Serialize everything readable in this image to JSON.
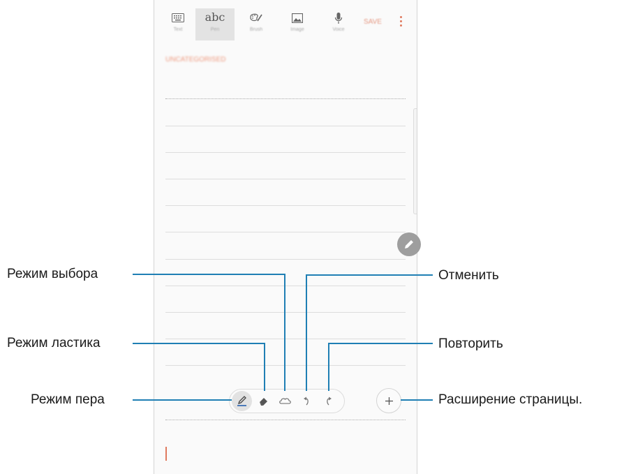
{
  "toolbar": {
    "items": [
      {
        "label": "Text",
        "icon": "keyboard-icon"
      },
      {
        "label": "Pen",
        "icon_text": "abc"
      },
      {
        "label": "Brush",
        "icon": "palette-brush-icon"
      },
      {
        "label": "Image",
        "icon": "image-icon"
      },
      {
        "label": "Voice",
        "icon": "microphone-icon"
      }
    ],
    "save_label": "SAVE",
    "more_icon": "more-vert-icon"
  },
  "note": {
    "title_placeholder": "UNCATEGORISED"
  },
  "pen_toolbar": {
    "tools": [
      "pen-mode-icon",
      "eraser-mode-icon",
      "selection-mode-icon",
      "undo-icon",
      "redo-icon"
    ],
    "expand_icon": "plus-icon"
  },
  "callouts": {
    "selection_mode": "Режим выбора",
    "eraser_mode": "Режим ластика",
    "pen_mode": "Режим пера",
    "undo": "Отменить",
    "redo": "Повторить",
    "page_expansion": "Расширение страницы."
  },
  "colors": {
    "accent": "#e07a5f",
    "callout_line": "#1f7fb4"
  }
}
